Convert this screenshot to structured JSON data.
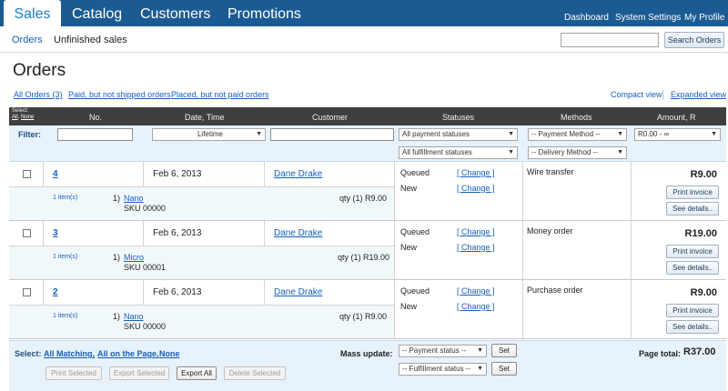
{
  "nav": {
    "tabs": [
      "Sales",
      "Catalog",
      "Customers",
      "Promotions"
    ],
    "links": [
      "Dashboard",
      "System Settings",
      "My Profile"
    ]
  },
  "subnav": {
    "orders": "Orders",
    "unfinished": "Unfinished sales",
    "search_button": "Search Orders",
    "search_value": ""
  },
  "page": {
    "title": "Orders",
    "quick_filters": [
      "All Orders (3)",
      "Paid, but not shipped orders",
      "Placed, but not paid orders"
    ],
    "compact_view": "Compact view",
    "expanded_view": "Expanded view"
  },
  "table": {
    "select_label": "Select:",
    "select_all": "All",
    "select_none": "None",
    "headers": [
      "No.",
      "Date, Time",
      "Customer",
      "Statuses",
      "Methods",
      "Amount, R"
    ]
  },
  "filter": {
    "label": "Filter:",
    "date_value": "Lifetime",
    "payment_status": "All payment statuses",
    "fulfillment_status": "All fulfillment statuses",
    "payment_method": "-- Payment Method --",
    "delivery_method": "-- Delivery Method --",
    "amount": "R0.00 - ∞"
  },
  "orders": [
    {
      "no": "4",
      "date": "Feb 6, 2013",
      "customer": "Dane Drake",
      "items_count": "1 item(s)",
      "item_index": "1)",
      "product": "Nano",
      "sku": "SKU 00000",
      "qty": "qty (1)  R9.00",
      "status1": "Queued",
      "status2": "New",
      "change": "[ Change ]",
      "method": "Wire transfer",
      "amount": "R9.00",
      "print": "Print invoice",
      "details": "See details.."
    },
    {
      "no": "3",
      "date": "Feb 6, 2013",
      "customer": "Dane Drake",
      "items_count": "1 item(s)",
      "item_index": "1)",
      "product": "Micro",
      "sku": "SKU 00001",
      "qty": "qty (1)  R19.00",
      "status1": "Queued",
      "status2": "New",
      "change": "[ Change ]",
      "method": "Money order",
      "amount": "R19.00",
      "print": "Print invoice",
      "details": "See details.."
    },
    {
      "no": "2",
      "date": "Feb 6, 2013",
      "customer": "Dane Drake",
      "items_count": "1 item(s)",
      "item_index": "1)",
      "product": "Nano",
      "sku": "SKU 00000",
      "qty": "qty (1)  R9.00",
      "status1": "Queued",
      "status2": "New",
      "change": "[ Change ]",
      "method": "Purchase order",
      "amount": "R9.00",
      "print": "Print invoice",
      "details": "See details.."
    }
  ],
  "footer": {
    "select_label": "Select:",
    "all_matching": "All Matching,",
    "all_on_page": "All on the Page,",
    "none": "None",
    "mass_update": "Mass update:",
    "payment_status_sel": "-- Payment status --",
    "fulfillment_status_sel": "-- Fulfillment status --",
    "set": "Set",
    "page_total_label": "Page total:",
    "page_total": "R37.00",
    "buttons": [
      "Print Selected",
      "Export Selected",
      "Export All",
      "Delete Selected"
    ]
  },
  "colors": {
    "nav_bg": "#1b5b93",
    "link": "#1560bd",
    "header_bg": "#3f3f3f",
    "filter_bg": "#e7f2fb"
  }
}
